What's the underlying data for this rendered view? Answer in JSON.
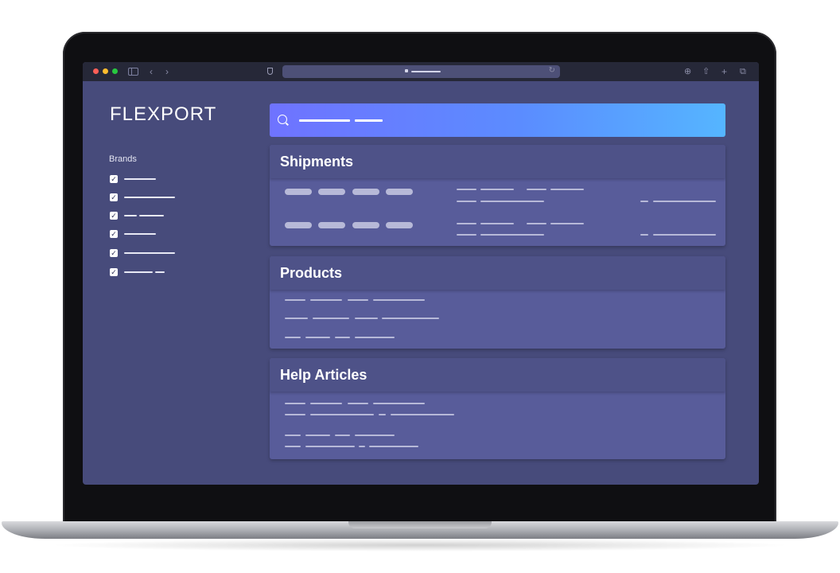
{
  "app": {
    "logo": "FLEXPORT"
  },
  "sidebar": {
    "heading": "Brands",
    "items": [
      {
        "checked": true,
        "check_glyph": "✓"
      },
      {
        "checked": true,
        "check_glyph": "✓"
      },
      {
        "checked": true,
        "check_glyph": "✓"
      },
      {
        "checked": true,
        "check_glyph": "✓"
      },
      {
        "checked": true,
        "check_glyph": "✓"
      },
      {
        "checked": true,
        "check_glyph": "✓"
      }
    ]
  },
  "search": {
    "icon": "search-icon"
  },
  "sections": {
    "shipments": {
      "title": "Shipments"
    },
    "products": {
      "title": "Products"
    },
    "help": {
      "title": "Help Articles"
    }
  },
  "colors": {
    "screen_bg": "#474b7b",
    "panel_bg": "#585c9a",
    "search_gradient_start": "#6f73ff",
    "search_gradient_end": "#55b5ff"
  }
}
